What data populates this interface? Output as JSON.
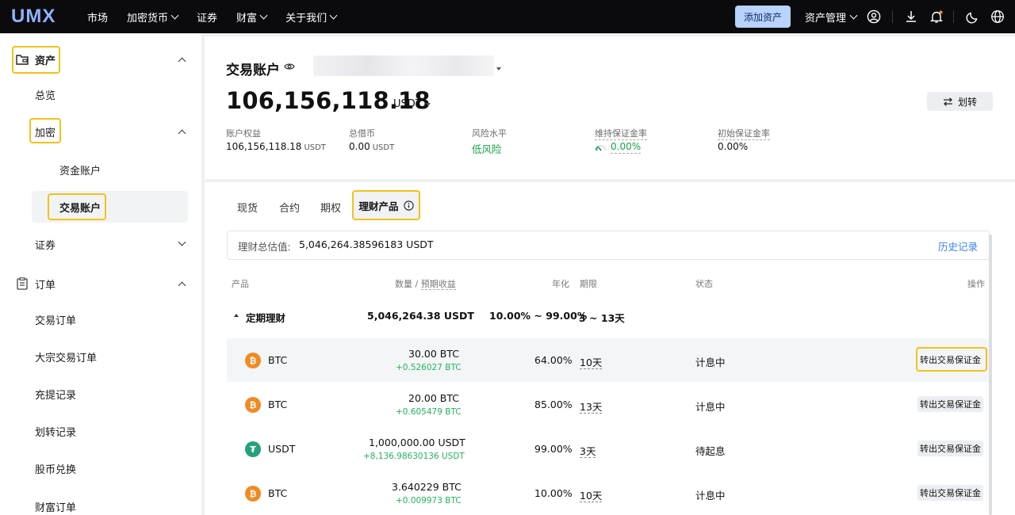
{
  "navbar": {
    "logo": "UMX",
    "items": [
      "市场",
      "加密货币",
      "证券",
      "财富",
      "关于我们"
    ],
    "add_asset": "添加资产",
    "asset_management": "资产管理"
  },
  "sidebar": {
    "assets": "资产",
    "overview": "总览",
    "crypto": "加密",
    "fund_account": "资金账户",
    "trading_account": "交易账户",
    "securities": "证券",
    "orders": "订单",
    "order_items": [
      "交易订单",
      "大宗交易订单",
      "充提记录",
      "划转记录",
      "股币兑换",
      "财富订单"
    ]
  },
  "account": {
    "title": "交易账户",
    "balance": "106,156,118.18",
    "unit": "USDT",
    "transfer": "划转",
    "stats": [
      {
        "label": "账户权益",
        "value": "106,156,118.18",
        "unit": "USDT"
      },
      {
        "label": "总借币",
        "value": "0.00",
        "unit": "USDT"
      },
      {
        "label": "风险水平",
        "value": "低风险"
      },
      {
        "label": "维持保证金率",
        "value": "0.00%"
      },
      {
        "label": "初始保证金率",
        "value": "0.00%"
      }
    ]
  },
  "tabs": [
    "现货",
    "合约",
    "期权",
    "理财产品"
  ],
  "summary": {
    "label": "理财总估值:",
    "value": "5,046,264.38596183 USDT",
    "history": "历史记录"
  },
  "table": {
    "headers": {
      "product": "产品",
      "qty": "数量",
      "slash": " / ",
      "est_income": "预期收益",
      "apr": "年化",
      "term": "期限",
      "status": "状态",
      "action": "操作"
    },
    "group": {
      "name": "定期理财",
      "amount": "5,046,264.38 USDT",
      "apr": "10.00% ~ 99.00%",
      "term": "3 ~ 13天"
    },
    "rows": [
      {
        "coin": "BTC",
        "amount": "30.00 BTC",
        "income": "+0.526027 BTC",
        "apr": "64.00%",
        "term": "10天",
        "status": "计息中",
        "action": "转出交易保证金"
      },
      {
        "coin": "BTC",
        "amount": "20.00 BTC",
        "income": "+0.605479 BTC",
        "apr": "85.00%",
        "term": "13天",
        "status": "计息中",
        "action": "转出交易保证金"
      },
      {
        "coin": "USDT",
        "amount": "1,000,000.00 USDT",
        "income": "+8,136.98630136 USDT",
        "apr": "99.00%",
        "term": "3天",
        "status": "待起息",
        "action": "转出交易保证金"
      },
      {
        "coin": "BTC",
        "amount": "3.640229 BTC",
        "income": "+0.009973 BTC",
        "apr": "10.00%",
        "term": "10天",
        "status": "计息中",
        "action": "转出交易保证金"
      }
    ]
  },
  "colors": {
    "highlight": "#f4c21a",
    "accent_blue": "#3b82f6",
    "green": "#16a34a",
    "btc": "#f08b22",
    "usdt": "#26a17b"
  }
}
